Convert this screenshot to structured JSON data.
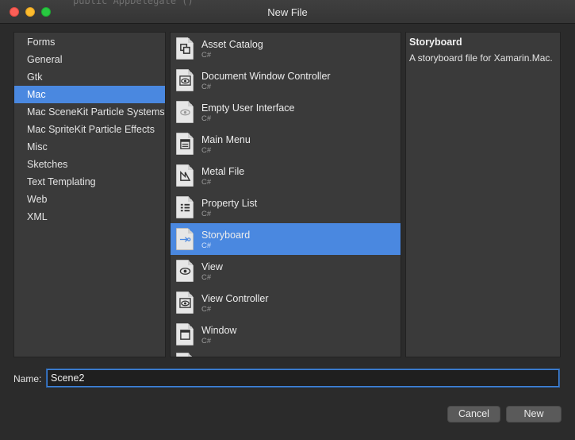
{
  "window": {
    "title": "New File",
    "behind_text": "public AppDelegate ()"
  },
  "categories": [
    {
      "label": "Forms",
      "selected": false
    },
    {
      "label": "General",
      "selected": false
    },
    {
      "label": "Gtk",
      "selected": false
    },
    {
      "label": "Mac",
      "selected": true
    },
    {
      "label": "Mac SceneKit Particle Systems",
      "selected": false
    },
    {
      "label": "Mac SpriteKit Particle Effects",
      "selected": false
    },
    {
      "label": "Misc",
      "selected": false
    },
    {
      "label": "Sketches",
      "selected": false
    },
    {
      "label": "Text Templating",
      "selected": false
    },
    {
      "label": "Web",
      "selected": false
    },
    {
      "label": "XML",
      "selected": false
    }
  ],
  "templates": [
    {
      "name": "Asset Catalog",
      "lang": "C#",
      "icon": "asset-catalog-icon",
      "selected": false
    },
    {
      "name": "Document Window Controller",
      "lang": "C#",
      "icon": "document-window-controller-icon",
      "selected": false
    },
    {
      "name": "Empty User Interface",
      "lang": "C#",
      "icon": "empty-user-interface-icon",
      "selected": false
    },
    {
      "name": "Main Menu",
      "lang": "C#",
      "icon": "main-menu-icon",
      "selected": false
    },
    {
      "name": "Metal File",
      "lang": "C#",
      "icon": "metal-file-icon",
      "selected": false
    },
    {
      "name": "Property List",
      "lang": "C#",
      "icon": "property-list-icon",
      "selected": false
    },
    {
      "name": "Storyboard",
      "lang": "C#",
      "icon": "storyboard-icon",
      "selected": true
    },
    {
      "name": "View",
      "lang": "C#",
      "icon": "view-icon",
      "selected": false
    },
    {
      "name": "View Controller",
      "lang": "C#",
      "icon": "view-controller-icon",
      "selected": false
    },
    {
      "name": "Window",
      "lang": "C#",
      "icon": "window-icon",
      "selected": false
    }
  ],
  "description": {
    "title": "Storyboard",
    "text": "A storyboard file for Xamarin.Mac."
  },
  "name_field": {
    "label": "Name:",
    "value": "Scene2"
  },
  "buttons": {
    "cancel": "Cancel",
    "new": "New"
  },
  "colors": {
    "selection": "#4a88e0",
    "panel": "#3a3a3a",
    "background": "#2b2b2b"
  }
}
